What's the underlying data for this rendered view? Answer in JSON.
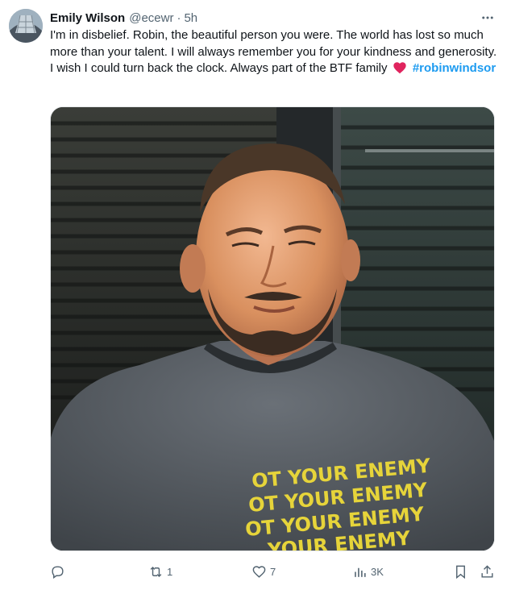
{
  "author": {
    "name": "Emily Wilson",
    "handle": "@ecewr",
    "separator": "·",
    "time": "5h"
  },
  "tweet": {
    "text": "I'm in disbelief. Robin, the beautiful person you were. The world has lost so much more than your talent. I will always remember you for your kindness and generosity. I wish I could turn back the clock. Always part of the BTF family",
    "hashtag": "#robinwindsor"
  },
  "media": {
    "shirt_lines": [
      "OT YOUR ENEMY",
      "OT YOUR ENEMY",
      "OT YOUR ENEMY",
      "YOUR ENEMY"
    ]
  },
  "actions": {
    "reply_count": "",
    "repost_count": "1",
    "like_count": "7",
    "views_count": "3K"
  },
  "icons": {
    "more": "more-icon",
    "reply": "reply-icon",
    "repost": "repost-icon",
    "like": "like-icon",
    "views": "views-icon",
    "bookmark": "bookmark-icon",
    "share": "share-icon",
    "heart": "heart-icon"
  },
  "colors": {
    "text": "#0f1419",
    "secondary": "#536471",
    "link": "#1d9bf0",
    "heart": "#e0245e",
    "shirt": "#5b6168",
    "shirt_print": "#e6d43a"
  }
}
